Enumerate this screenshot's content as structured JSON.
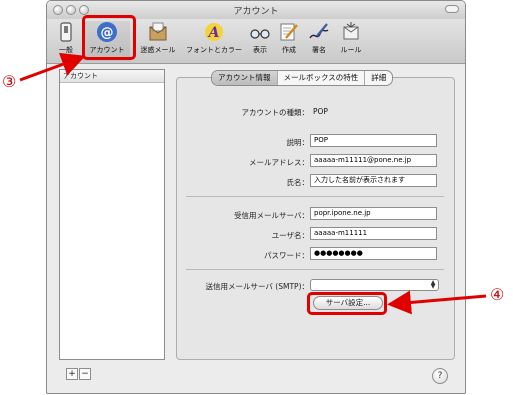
{
  "window": {
    "title": "アカウント"
  },
  "toolbar": {
    "items": [
      {
        "label": "一般",
        "icon": "switch-icon"
      },
      {
        "label": "アカウント",
        "icon": "at-sign-icon"
      },
      {
        "label": "迷惑メール",
        "icon": "junk-mail-icon"
      },
      {
        "label": "フォントとカラー",
        "icon": "font-color-icon"
      },
      {
        "label": "表示",
        "icon": "glasses-icon"
      },
      {
        "label": "作成",
        "icon": "compose-icon"
      },
      {
        "label": "署名",
        "icon": "signature-icon"
      },
      {
        "label": "ルール",
        "icon": "rules-icon"
      }
    ]
  },
  "sidebar": {
    "header": "アカウント",
    "add_label": "+",
    "remove_label": "−"
  },
  "tabs": [
    "アカウント情報",
    "メールボックスの特性",
    "詳細"
  ],
  "form": {
    "account_type_label": "アカウントの種類：",
    "account_type_value": "POP",
    "description_label": "説明：",
    "description_value": "POP",
    "email_label": "メールアドレス：",
    "email_value": "aaaaa-m11111@pone.ne.jp",
    "fullname_label": "氏名：",
    "fullname_value": "入力した名前が表示されます",
    "incoming_server_label": "受信用メールサーバ：",
    "incoming_server_value": "popr.ipone.ne.jp",
    "username_label": "ユーザ名：",
    "username_value": "aaaaa-m11111",
    "password_label": "パスワード：",
    "password_value": "●●●●●●●●",
    "smtp_label": "送信用メールサーバ (SMTP)：",
    "smtp_value": "",
    "server_settings_label": "サーバ設定..."
  },
  "help": {
    "label": "?"
  },
  "annotations": {
    "step3": "③",
    "step4": "④",
    "color": "#e00000"
  }
}
